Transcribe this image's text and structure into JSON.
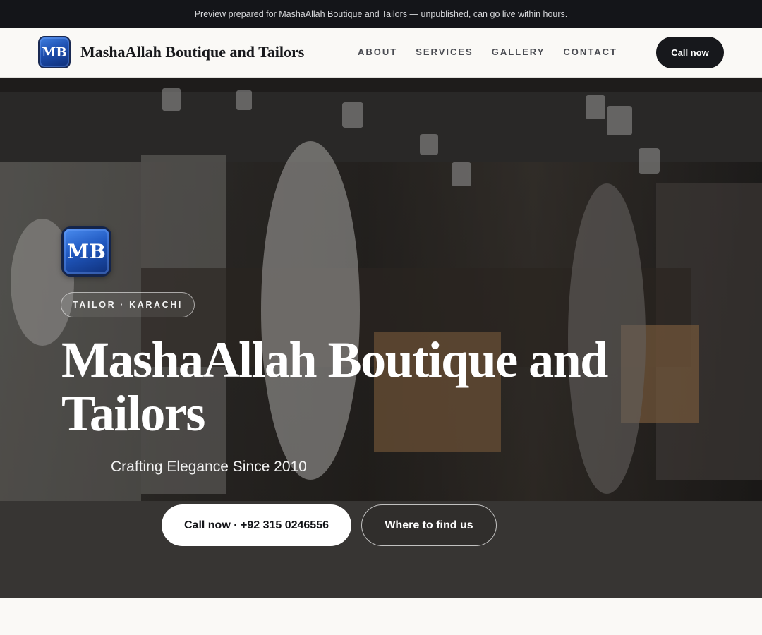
{
  "preview_banner": {
    "text": "Preview prepared for MashaAllah Boutique and Tailors — unpublished, can go live within hours."
  },
  "header": {
    "logo_initials": "MB",
    "brand_name": "MashaAllah Boutique and Tailors",
    "nav": [
      {
        "label": "ABOUT"
      },
      {
        "label": "SERVICES"
      },
      {
        "label": "GALLERY"
      },
      {
        "label": "CONTACT"
      }
    ],
    "cta_label": "Call now"
  },
  "hero": {
    "logo_initials": "MB",
    "tag": "TAILOR · KARACHI",
    "title": "MashaAllah Boutique and Tailors",
    "subtitle": "Crafting Elegance Since 2010",
    "primary_cta": "Call now · +92 315 0246556",
    "secondary_cta": "Where to find us",
    "background_image": "boutique-interior-photo"
  },
  "colors": {
    "dark": "#141519",
    "page_background": "#faf9f6",
    "logo_blue": "#1d4fb0"
  }
}
